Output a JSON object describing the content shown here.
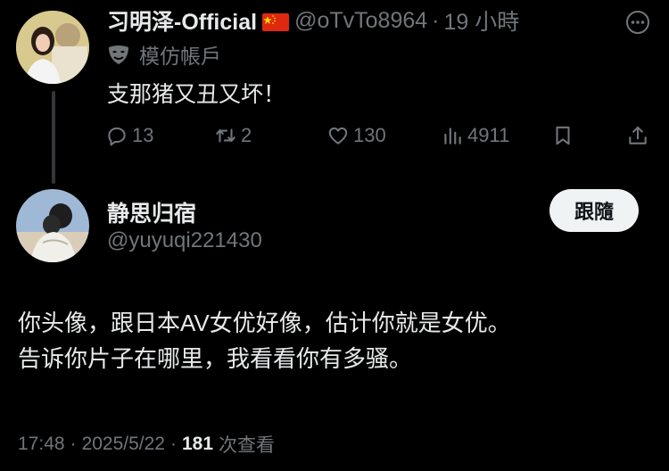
{
  "parent_tweet": {
    "display_name": "习明泽-Official",
    "flag_icon": "china-flag-icon",
    "handle": "@oTvTo8964",
    "separator": "·",
    "time_ago": "19 小時",
    "more_icon": "more-icon",
    "parody_icon": "parody-mask-icon",
    "parody_label": "模仿帳戶",
    "text": "支那猪又丑又坏！",
    "actions": {
      "reply_count": "13",
      "retweet_count": "2",
      "like_count": "130",
      "view_count": "4911"
    }
  },
  "reply_tweet": {
    "display_name": "静思归宿",
    "handle": "@yuyuqi221430",
    "follow_label": "跟隨",
    "body_lines": [
      "你头像，跟日本AV女优好像，估计你就是女优。",
      "告诉你片子在哪里，我看看你有多骚。"
    ],
    "meta": {
      "time": "17:48",
      "separator": "·",
      "date": "2025/5/22",
      "views_count": "181",
      "views_label": "次查看"
    }
  },
  "colors": {
    "background": "#000000",
    "primary_text": "#e7e9ea",
    "secondary_text": "#71767b",
    "thread_line": "#333639",
    "follow_button_bg": "#eff3f4"
  }
}
